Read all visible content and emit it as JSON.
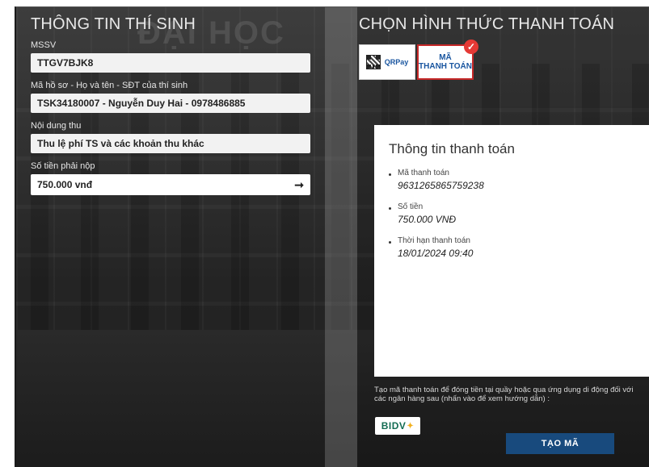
{
  "left": {
    "title": "THÔNG TIN THÍ SINH",
    "fields": [
      {
        "label": "MSSV",
        "value": "TTGV7BJK8"
      },
      {
        "label": "Mã hồ sơ - Họ và tên - SĐT của thí sinh",
        "value": "TSK34180007 - Nguyễn Duy Hai - 0978486885"
      },
      {
        "label": "Nội dung thu",
        "value": "Thu lệ phí TS  và các khoản thu khác"
      },
      {
        "label": "Số tiền phải nộp",
        "value": "750.000 vnđ"
      }
    ]
  },
  "right": {
    "title": "CHỌN HÌNH THỨC THANH TOÁN",
    "methods": {
      "qr_label": "QRPay",
      "code_line1": "MÃ",
      "code_line2": "THANH TOÁN"
    },
    "card": {
      "title": "Thông tin thanh toán",
      "items": [
        {
          "label": "Mã thanh toán",
          "value": "9631265865759238"
        },
        {
          "label": "Số tiền",
          "value": "750.000 VNĐ"
        },
        {
          "label": "Thời hạn thanh toán",
          "value": "18/01/2024 09:40"
        }
      ]
    },
    "note": "Tạo mã thanh toán để đóng tiền tại quầy hoặc qua ứng dụng di động đối với các ngân hàng sau (nhấn vào để xem hướng dẫn) :",
    "bank": "BIDV",
    "submit_label": "TẠO MÃ"
  },
  "colors": {
    "button_blue": "#184a7d",
    "selected_border": "#c62828",
    "check_red": "#e53935",
    "bidv_green": "#136c53"
  },
  "icons": {
    "qr": "qr-code-icon",
    "check": "checkmark-icon",
    "arrow": "arrow-right-icon"
  }
}
